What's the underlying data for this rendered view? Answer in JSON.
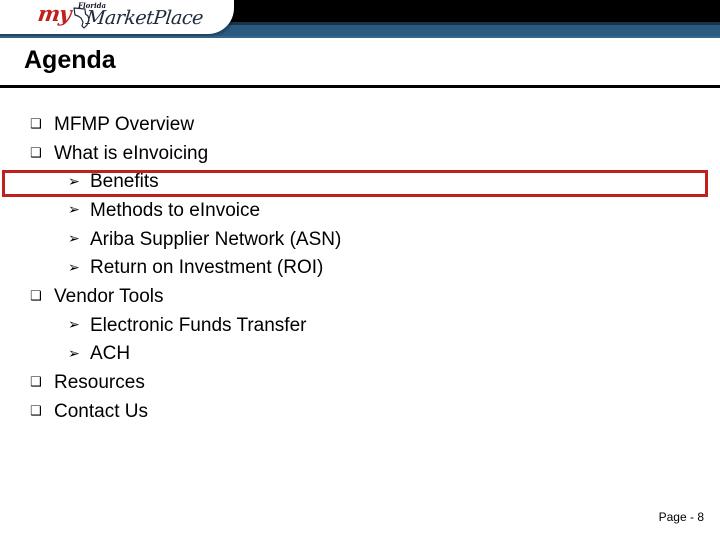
{
  "header": {
    "logo": {
      "my_text": "my",
      "florida_text": "Florida",
      "marketplace_text": "MarketPlace",
      "state_outline_icon": "florida-state-outline-icon",
      "accent_red": "#c0201f",
      "script_navy": "#1f2a3d"
    },
    "band_black": "#000000",
    "band_blue": "#2a5a80"
  },
  "slide": {
    "title": "Agenda",
    "page_label": "Page - 8",
    "rule_color": "#000000",
    "highlight_color": "#c0201f"
  },
  "agenda": {
    "square_bullet": "❑",
    "arrow_bullet": "➢",
    "items": [
      {
        "level": 1,
        "label": "MFMP Overview",
        "highlighted": false
      },
      {
        "level": 1,
        "label": "What is eInvoicing",
        "highlighted": false
      },
      {
        "level": 2,
        "label": "Benefits",
        "highlighted": true
      },
      {
        "level": 2,
        "label": "Methods to eInvoice",
        "highlighted": false
      },
      {
        "level": 2,
        "label": "Ariba Supplier Network (ASN)",
        "highlighted": false
      },
      {
        "level": 2,
        "label": "Return on Investment (ROI)",
        "highlighted": false
      },
      {
        "level": 1,
        "label": "Vendor Tools",
        "highlighted": false
      },
      {
        "level": 2,
        "label": "Electronic Funds Transfer",
        "highlighted": false
      },
      {
        "level": 2,
        "label": "ACH",
        "highlighted": false
      },
      {
        "level": 1,
        "label": "Resources",
        "highlighted": false
      },
      {
        "level": 1,
        "label": "Contact Us",
        "highlighted": false
      }
    ]
  }
}
